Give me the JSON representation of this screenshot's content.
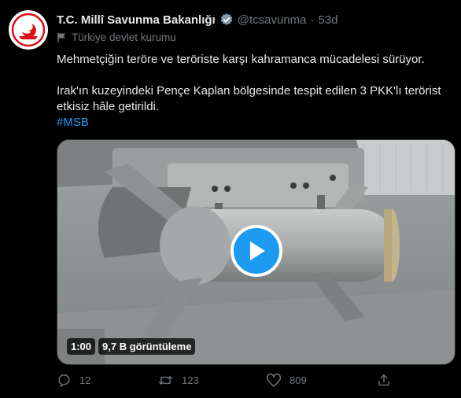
{
  "author": {
    "name": "T.C. Millî Savunma Bakanlığı",
    "handle": "@tcsavunma",
    "separator": "·",
    "time": "53d",
    "verified_icon": "verified-badge-icon",
    "label_icon": "flag-icon",
    "label": "Türkiye devlet kurumu"
  },
  "tweet": {
    "line1": "Mehmetçiğin teröre ve teröriste karşı kahramanca mücadelesi sürüyor.",
    "line2": "Irak'ın kuzeyindeki Pençe Kaplan bölgesinde tespit edilen 3 PKK'lı terörist etkisiz hâle getirildi.",
    "hashtag": "#MSB"
  },
  "media": {
    "duration": "1:00",
    "views": "9,7 B görüntüleme",
    "play_icon": "play-icon"
  },
  "actions": {
    "reply_count": "12",
    "retweet_count": "123",
    "like_count": "809"
  },
  "colors": {
    "accent": "#1d9bf0",
    "muted": "#71767b",
    "background": "#000000",
    "seal_red": "#e30a17"
  }
}
